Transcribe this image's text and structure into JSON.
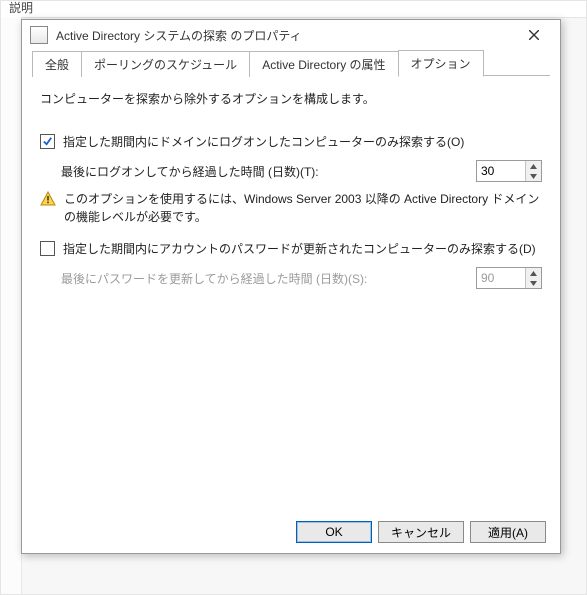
{
  "scrap": {
    "top_label": "説明"
  },
  "dialog": {
    "title": "Active Directory システムの探索 のプロパティ",
    "tabs": [
      {
        "label": "全般"
      },
      {
        "label": "ポーリングのスケジュール"
      },
      {
        "label": "Active Directory の属性"
      },
      {
        "label": "オプション"
      }
    ],
    "active_tab_index": 3,
    "intro": "コンピューターを探索から除外するオプションを構成します。",
    "opt_logon": {
      "checked": true,
      "label": "指定した期間内にドメインにログオンしたコンピューターのみ探索する(O)",
      "sub_label": "最後にログオンしてから経過した時間 (日数)(T):",
      "value": "30"
    },
    "warning": "このオプションを使用するには、Windows Server 2003 以降の Active Directory ドメインの機能レベルが必要です。",
    "opt_pwd": {
      "checked": false,
      "label": "指定した期間内にアカウントのパスワードが更新されたコンピューターのみ探索する(D)",
      "sub_label": "最後にパスワードを更新してから経過した時間 (日数)(S):",
      "value": "90"
    },
    "buttons": {
      "ok": "OK",
      "cancel": "キャンセル",
      "apply": "適用(A)"
    }
  }
}
